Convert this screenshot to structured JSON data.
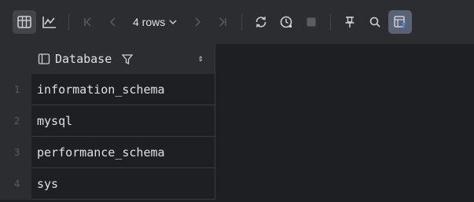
{
  "toolbar": {
    "rows_label": "4 rows",
    "icons": [
      "table-view-icon",
      "chart-view-icon",
      "first-page-icon",
      "previous-page-icon",
      "next-page-icon",
      "last-page-icon",
      "refresh-icon",
      "history-icon",
      "stop-icon",
      "pin-icon",
      "search-icon",
      "filter-panel-icon"
    ]
  },
  "table": {
    "column_header": "Database",
    "rows": [
      {
        "num": "1",
        "value": "information_schema"
      },
      {
        "num": "2",
        "value": "mysql"
      },
      {
        "num": "3",
        "value": "performance_schema"
      },
      {
        "num": "4",
        "value": "sys"
      }
    ]
  },
  "colors": {
    "toolbar_bg": "#2b2d30",
    "grid_bg": "#1e1f22",
    "accent": "#4f7fd6"
  }
}
